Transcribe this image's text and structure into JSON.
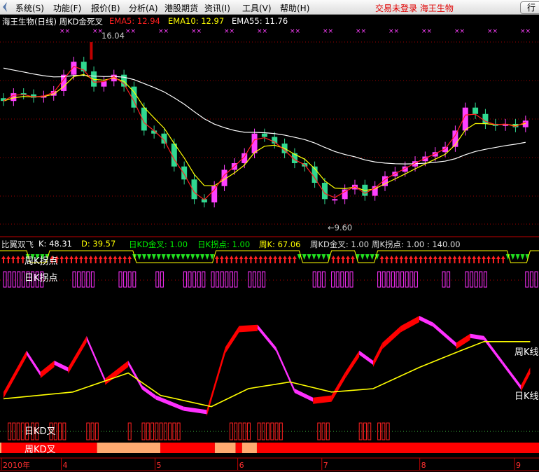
{
  "menu": {
    "items": [
      "系统(S)",
      "功能(F)",
      "报价(B)",
      "分析(A)",
      "港股期货",
      "资讯(I)",
      "工具(V)",
      "帮助(H)"
    ],
    "status": "交易未登录 海王生物",
    "right_button": "行"
  },
  "main": {
    "title": "海王生物(日线) 周KD金死叉",
    "ema5": "EMA5: 12.94",
    "ema10": "EMA10: 12.97",
    "ema55": "EMA55: 11.76",
    "high_label": "16.04",
    "low_label": "←9.60"
  },
  "indicator": {
    "name": "比翼双飞",
    "k": "K: 48.31",
    "d": "D: 39.57",
    "dkd": "日KD金叉: 1.00",
    "dk_turn": "日K拐点: 1.00",
    "wk": "周K: 67.06",
    "wkd": "周KD金叉: 1.00",
    "wk_turn": "周K拐点: 1.00 : 140.00",
    "label_week_turn": "周K拐点",
    "label_day_turn": "日K拐点",
    "label_week_line": "周K线",
    "label_day_line": "日K线",
    "label_day_kd": "日KD叉",
    "label_week_kd": "周KD叉"
  },
  "axis": {
    "labels": [
      {
        "day": 0,
        "text": "2010年"
      },
      {
        "day": 12.5,
        "text": "4"
      },
      {
        "day": 32.8,
        "text": "5"
      },
      {
        "day": 50.7,
        "text": "6"
      },
      {
        "day": 68.9,
        "text": "7"
      },
      {
        "day": 90.1,
        "text": "8"
      },
      {
        "day": 110.6,
        "text": "9"
      }
    ]
  },
  "colors": {
    "up": "#ff40ff",
    "down": "#30d890",
    "ema5": "#ff2020",
    "ema10": "#ffff00",
    "ema55": "#ffffff",
    "k_up": "#ff0000",
    "k_down": "#ff30ff",
    "weekK": "#ffff00",
    "wk_red": "#ff0000",
    "wk_orange": "#ffaa70"
  },
  "chart_data": {
    "type": "candlestick",
    "title": "海王生物(日线) 周KD金死叉",
    "days": 114,
    "ylim": [
      9.0,
      16.6
    ],
    "close": [
      13.91,
      14.19,
      14.15,
      14.03,
      14.1,
      14.27,
      14.86,
      15.33,
      14.98,
      14.43,
      14.62,
      14.86,
      14.43,
      13.67,
      12.84,
      12.73,
      12.37,
      11.54,
      11.07,
      10.36,
      10.24,
      10.83,
      11.42,
      11.66,
      12.02,
      12.73,
      12.61,
      12.37,
      12.02,
      11.66,
      11.54,
      10.95,
      10.36,
      10.36,
      10.71,
      10.88,
      10.48,
      10.83,
      11.19,
      11.35,
      11.54,
      11.73,
      11.9,
      12.06,
      12.25,
      12.84,
      13.67,
      13.44,
      13.08,
      13.01,
      13.08,
      12.96,
      13.2
    ],
    "high_point": {
      "day": 19,
      "value": 16.04
    },
    "low_point": {
      "day": 70,
      "value": 9.6
    },
    "ema55_seed": 15.2,
    "daily_k": [
      [
        0,
        22
      ],
      [
        5,
        59
      ],
      [
        8,
        40
      ],
      [
        11,
        50
      ],
      [
        14,
        44
      ],
      [
        18,
        72
      ],
      [
        22,
        34
      ],
      [
        27,
        50
      ],
      [
        30,
        28
      ],
      [
        33,
        19
      ],
      [
        39,
        9
      ],
      [
        44,
        6
      ],
      [
        48,
        62
      ],
      [
        51,
        81
      ],
      [
        55,
        82
      ],
      [
        59,
        62
      ],
      [
        63,
        25
      ],
      [
        67,
        17
      ],
      [
        71,
        19
      ],
      [
        74,
        40
      ],
      [
        77,
        59
      ],
      [
        80,
        50
      ],
      [
        82,
        66
      ],
      [
        86,
        81
      ],
      [
        90,
        90
      ],
      [
        93,
        84
      ],
      [
        98,
        66
      ],
      [
        101,
        74
      ],
      [
        104,
        72
      ],
      [
        108,
        50
      ],
      [
        112,
        28
      ],
      [
        114,
        44
      ]
    ],
    "weekly_k": [
      [
        0,
        16
      ],
      [
        15,
        22
      ],
      [
        27,
        39
      ],
      [
        34,
        19
      ],
      [
        45,
        9
      ],
      [
        53,
        25
      ],
      [
        62,
        31
      ],
      [
        71,
        22
      ],
      [
        80,
        25
      ],
      [
        90,
        44
      ],
      [
        99,
        59
      ],
      [
        104,
        67
      ],
      [
        114,
        67
      ]
    ],
    "weekly_kd_segments": [
      [
        0,
        0.3,
        "orange"
      ],
      [
        0.3,
        21,
        "red"
      ],
      [
        21,
        34.7,
        "orange"
      ],
      [
        34.7,
        46.5,
        "red"
      ],
      [
        46.5,
        51,
        "orange"
      ],
      [
        51,
        52.4,
        "red"
      ],
      [
        52.4,
        55.6,
        "orange"
      ],
      [
        55.6,
        116.7,
        "red"
      ]
    ],
    "weekly_turn_down_ranges": [
      [
        5,
        10
      ],
      [
        28,
        46
      ],
      [
        64,
        71
      ],
      [
        76,
        81
      ],
      [
        109,
        114
      ]
    ],
    "daily_turn_boxes": [
      [
        0,
        1
      ],
      [
        2,
        5
      ],
      [
        6,
        8
      ],
      [
        15,
        19
      ],
      [
        25,
        28
      ],
      [
        33,
        34
      ],
      [
        39,
        41
      ],
      [
        42,
        43
      ],
      [
        45,
        50
      ],
      [
        53,
        56
      ],
      [
        67,
        69
      ],
      [
        71,
        75
      ],
      [
        81,
        89
      ],
      [
        95,
        96
      ],
      [
        100,
        104
      ],
      [
        113,
        115
      ]
    ],
    "daily_kd_boxes": [
      [
        1,
        5
      ],
      [
        6,
        7
      ],
      [
        10,
        13
      ],
      [
        18,
        20
      ],
      [
        27,
        27
      ],
      [
        30,
        38
      ],
      [
        49,
        53
      ],
      [
        55,
        60
      ],
      [
        68,
        70
      ],
      [
        77,
        79
      ],
      [
        81,
        83
      ]
    ]
  }
}
